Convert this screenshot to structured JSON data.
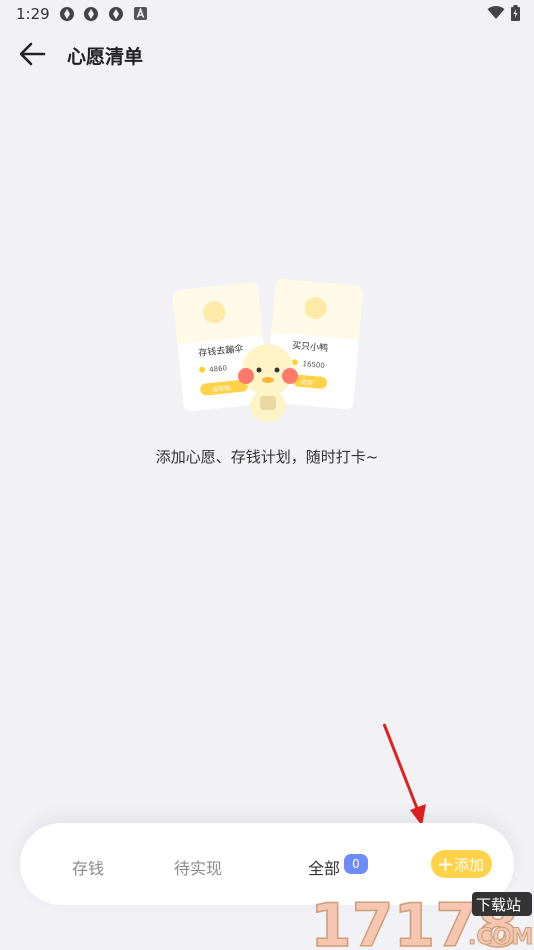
{
  "status_bar": {
    "time": "1:29"
  },
  "header": {
    "title": "心愿清单"
  },
  "illustration": {
    "card_left": {
      "title": "存钱去蹦伞",
      "amount": "4860",
      "button": "去存钱"
    },
    "card_right": {
      "title": "买只小鸭",
      "amount": "16500",
      "button": "去存"
    }
  },
  "empty_state": {
    "message": "添加心愿、存钱计划，随时打卡~"
  },
  "bottom_bar": {
    "tabs": [
      {
        "label": "存钱"
      },
      {
        "label": "待实现"
      },
      {
        "label": "全部"
      }
    ],
    "all_count": "0",
    "add_label": "添加"
  },
  "watermark": {
    "text": "17178",
    "subtext": "下载站",
    "domain": ".COM"
  },
  "colors": {
    "accent": "#ffd24a",
    "badge": "#6d8cf7",
    "background": "#f1f1f6",
    "arrow": "#e02020"
  }
}
